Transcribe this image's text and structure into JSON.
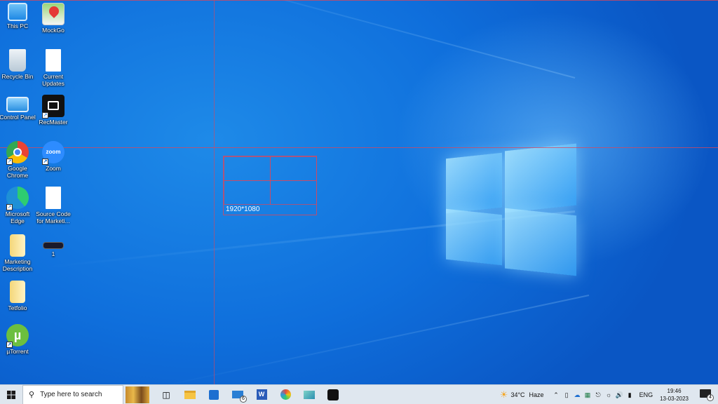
{
  "desktop": {
    "icons": [
      {
        "id": "this-pc",
        "label": "This PC"
      },
      {
        "id": "mockgo",
        "label": "MockGo"
      },
      {
        "id": "recycle-bin",
        "label": "Recycle Bin"
      },
      {
        "id": "current-updates",
        "label": "Current Updates"
      },
      {
        "id": "control-panel",
        "label": "Control Panel"
      },
      {
        "id": "recmaster",
        "label": "RecMaster"
      },
      {
        "id": "google-chrome",
        "label": "Google Chrome"
      },
      {
        "id": "zoom",
        "label": "Zoom"
      },
      {
        "id": "microsoft-edge",
        "label": "Microsoft Edge"
      },
      {
        "id": "source-code",
        "label": "Source Code for Marketi..."
      },
      {
        "id": "marketing-description",
        "label": "Marketing Description"
      },
      {
        "id": "file-1",
        "label": "1"
      },
      {
        "id": "tetfolio",
        "label": "Tetfolio"
      },
      {
        "id": "utorrent",
        "label": "µTorrent"
      }
    ],
    "zoom_icon_text": "zoom"
  },
  "selection": {
    "resolution_label": "1920*1080"
  },
  "taskbar": {
    "search_placeholder": "Type here to search",
    "mail_badge": "6",
    "weather": {
      "temp": "34°C",
      "condition": "Haze"
    },
    "language": "ENG",
    "time": "19:46",
    "date": "13-03-2023",
    "notification_count": "4"
  },
  "colors": {
    "desktop_blue": "#0f6fdc",
    "guide_red": "#dc465a",
    "taskbar_bg": "#dfe7ef"
  }
}
